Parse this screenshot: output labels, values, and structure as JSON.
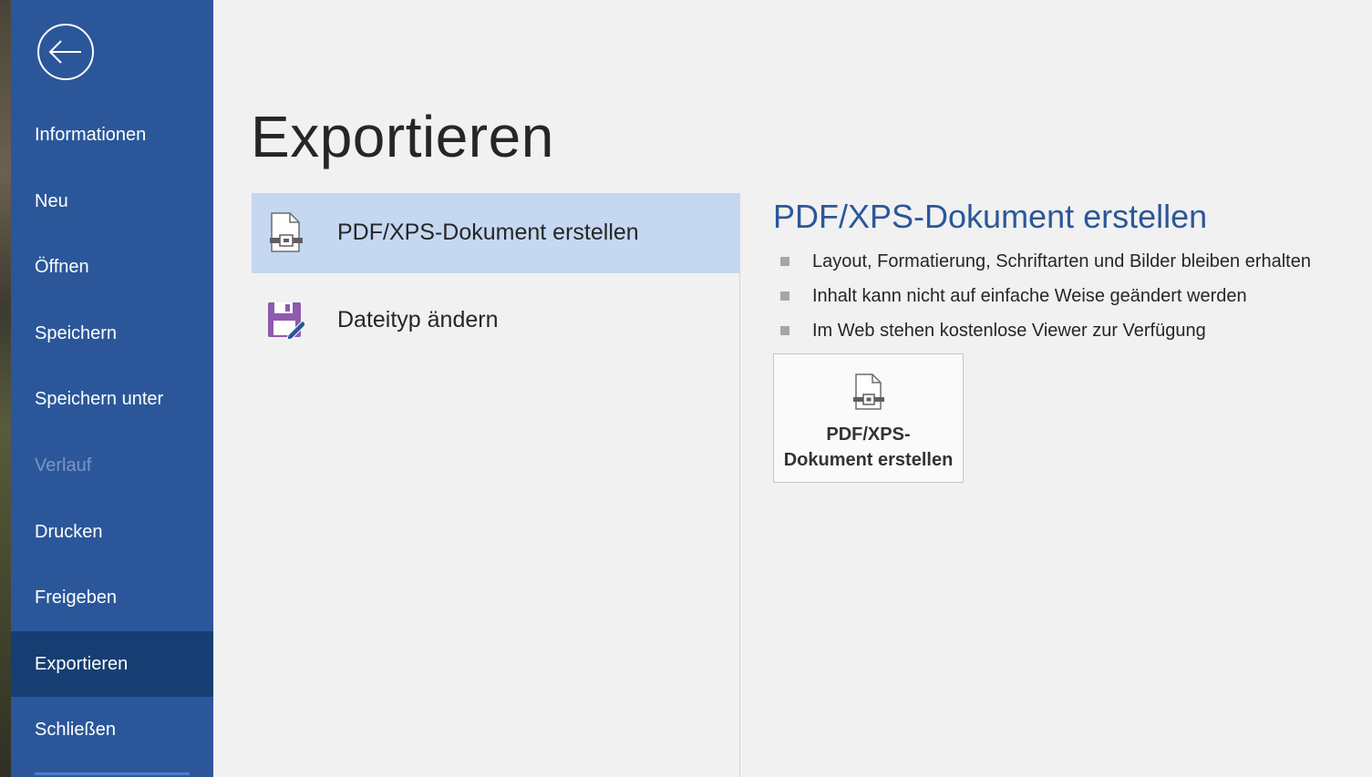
{
  "sidebar": {
    "back_icon": "back-arrow-icon",
    "items": [
      {
        "label": "Informationen",
        "state": "normal"
      },
      {
        "label": "Neu",
        "state": "normal"
      },
      {
        "label": "Öffnen",
        "state": "normal"
      },
      {
        "label": "Speichern",
        "state": "normal"
      },
      {
        "label": "Speichern unter",
        "state": "normal"
      },
      {
        "label": "Verlauf",
        "state": "disabled"
      },
      {
        "label": "Drucken",
        "state": "normal"
      },
      {
        "label": "Freigeben",
        "state": "normal"
      },
      {
        "label": "Exportieren",
        "state": "active"
      },
      {
        "label": "Schließen",
        "state": "normal"
      }
    ]
  },
  "main": {
    "title": "Exportieren",
    "options": [
      {
        "label": "PDF/XPS-Dokument erstellen",
        "icon": "pdf-xps-document-icon",
        "selected": true
      },
      {
        "label": "Dateityp ändern",
        "icon": "change-file-type-icon",
        "selected": false
      }
    ]
  },
  "detail": {
    "title": "PDF/XPS-Dokument erstellen",
    "bullets": [
      "Layout, Formatierung, Schriftarten und Bilder bleiben erhalten",
      "Inhalt kann nicht auf einfache Weise geändert werden",
      "Im Web stehen kostenlose Viewer zur Verfügung"
    ],
    "button": {
      "line1": "PDF/XPS-",
      "line2": "Dokument erstellen",
      "icon": "pdf-xps-document-icon"
    }
  },
  "colors": {
    "sidebar": "#2b579a",
    "sidebar_active": "#163e72",
    "selected_option": "#c5d7f1",
    "accent_text": "#2b579a",
    "background": "#f1f1f1"
  }
}
